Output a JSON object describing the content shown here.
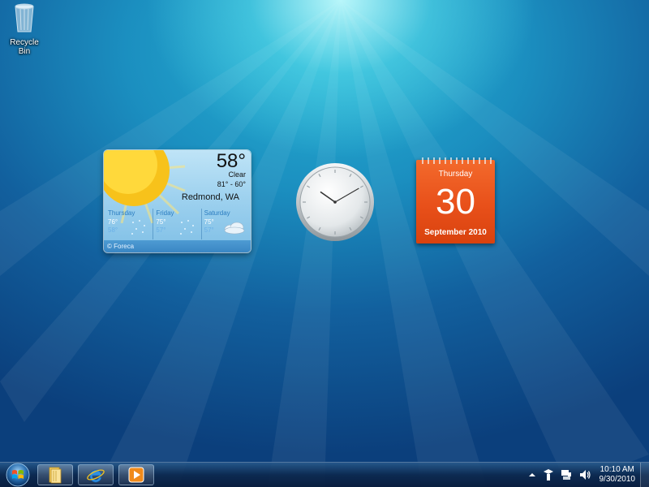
{
  "desktop": {
    "icons": [
      {
        "label": "Recycle Bin",
        "icon": "recycle-bin-icon"
      }
    ]
  },
  "weather": {
    "temperature": "58°",
    "condition": "Clear",
    "range": "81° - 60°",
    "location": "Redmond, WA",
    "forecast": [
      {
        "day": "Thursday",
        "high": "76°",
        "low": "58°",
        "icon": "clear-night-icon"
      },
      {
        "day": "Friday",
        "high": "75°",
        "low": "57°",
        "icon": "clear-night-icon"
      },
      {
        "day": "Saturday",
        "high": "75°",
        "low": "57°",
        "icon": "partly-cloudy-icon"
      }
    ],
    "credit": "© Foreca"
  },
  "clock": {
    "hour": 10,
    "minute": 10
  },
  "calendar": {
    "weekday": "Thursday",
    "day": "30",
    "month_year": "September 2010"
  },
  "taskbar": {
    "start_icon": "windows-start-icon",
    "pinned": [
      {
        "name": "windows-explorer",
        "icon": "folder-icon"
      },
      {
        "name": "internet-explorer",
        "icon": "internet-explorer-icon"
      },
      {
        "name": "windows-media-player",
        "icon": "media-player-icon"
      }
    ],
    "tray": {
      "icons": [
        "show-hidden-icons-icon",
        "action-center-icon",
        "network-icon",
        "volume-icon"
      ],
      "time": "10:10 AM",
      "date": "9/30/2010"
    }
  },
  "colors": {
    "calendar_accent": "#e8501a",
    "weather_bg": "#9fd2ef",
    "taskbar": "#0c284e"
  }
}
